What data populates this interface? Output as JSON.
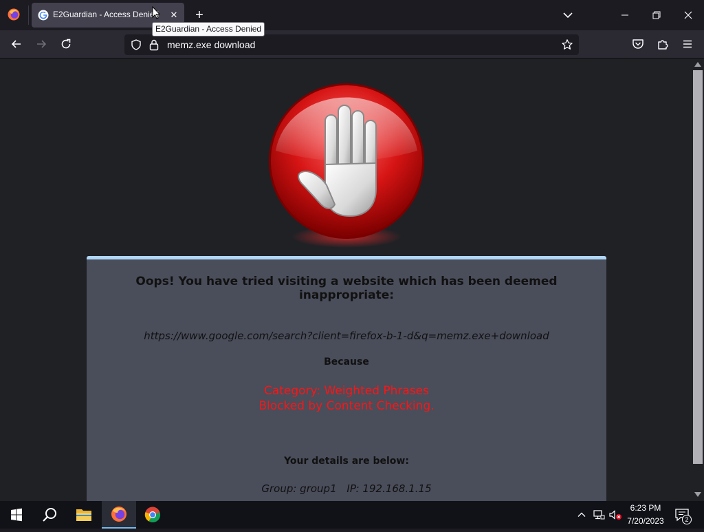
{
  "browser": {
    "tab": {
      "title": "E2Guardian - Access Denied",
      "close_glyph": "✕"
    },
    "new_tab_glyph": "+",
    "tooltip": "E2Guardian - Access Denied",
    "url": "memz.exe download"
  },
  "page": {
    "heading": "Oops! You have tried visiting a website which has been deemed inappropriate:",
    "blocked_url": "https://www.google.com/search?client=firefox-b-1-d&q=memz.exe+download",
    "because": "Because",
    "reason_category": "Category: Weighted Phrases",
    "reason_detail": "Blocked by Content Checking.",
    "details_label": "Your details are below:",
    "group": "Group: group1",
    "ip": "IP: 192.168.1.15"
  },
  "taskbar": {
    "time": "6:23 PM",
    "date": "7/20/2023",
    "notification_count": "2"
  },
  "colors": {
    "reason_text": "#ff1414",
    "card_top_border": "#aed6f5",
    "card_background": "#4a4d5a"
  }
}
